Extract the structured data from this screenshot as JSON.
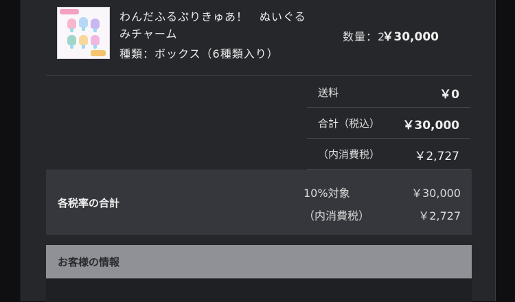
{
  "item": {
    "name": "わんだふるぷりきゅあ！　ぬいぐるみチャーム",
    "variant": "種類：ボックス（6種類入り）",
    "quantity": "数量：2",
    "price": "￥30,000"
  },
  "summary": {
    "shipping_label": "送料",
    "shipping_value": "￥0",
    "total_label": "合計（税込）",
    "total_value": "￥30,000",
    "tax_label": "（内消費税）",
    "tax_value": "￥2,727"
  },
  "tax_rates": {
    "title": "各税率の合計",
    "rate_label": "10%対象",
    "rate_value": "￥30,000",
    "tax_label": "（内消費税）",
    "tax_value": "￥2,727"
  },
  "customer": {
    "title": "お客様の情報"
  },
  "colors": {
    "page_bg": "#0f0f11",
    "panel_bg": "#26272b",
    "tax_box_bg": "#36373c",
    "section_bar_bg": "#8f9196"
  }
}
